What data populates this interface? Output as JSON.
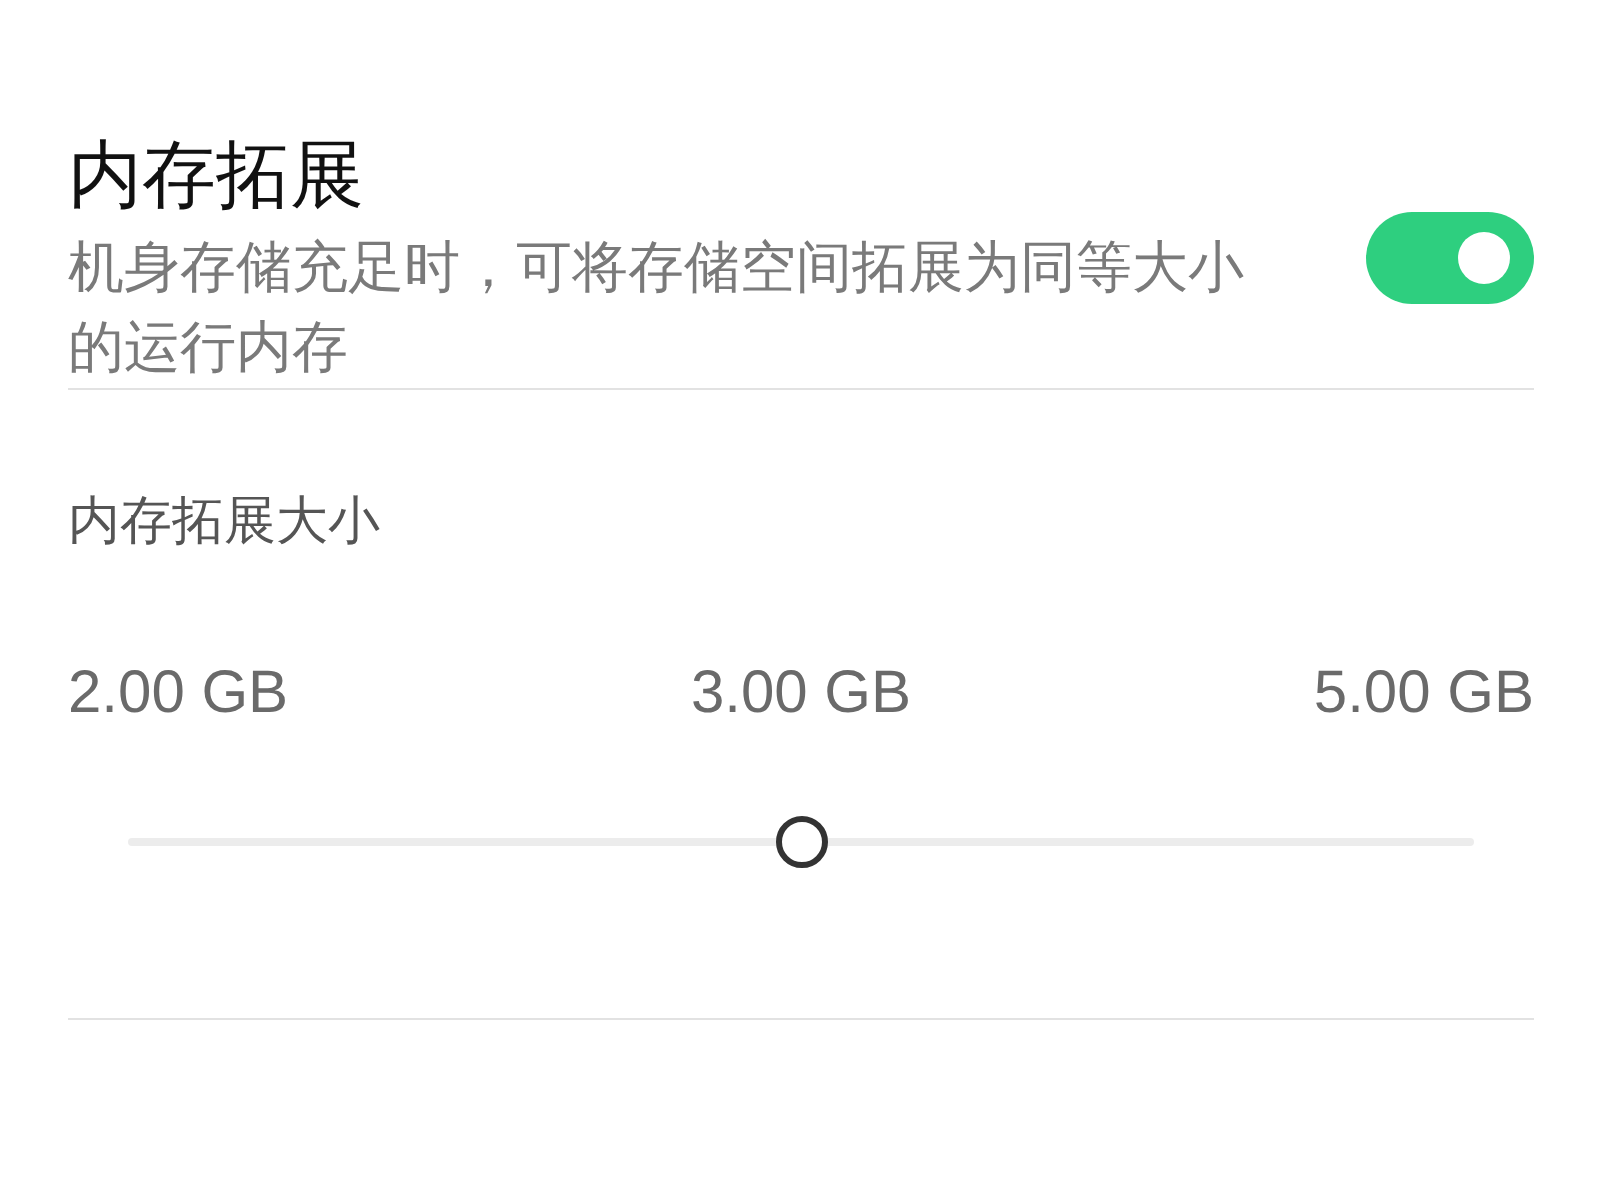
{
  "setting": {
    "title": "内存拓展",
    "description": "机身存储充足时，可将存储空间拓展为同等大小的运行内存",
    "on": true
  },
  "size": {
    "heading": "内存拓展大小",
    "options": [
      "2.00 GB",
      "3.00 GB",
      "5.00 GB"
    ],
    "level": 0.5
  }
}
